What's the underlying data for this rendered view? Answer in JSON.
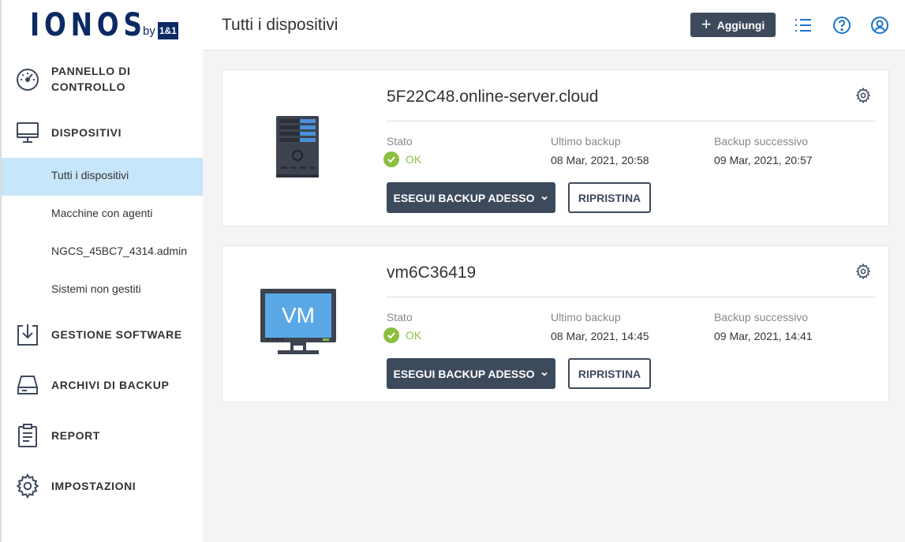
{
  "brand": {
    "name": "IONOS",
    "by": "by",
    "partner": "1&1"
  },
  "sidebar": {
    "items": [
      {
        "label": "PANNELLO DI\nCONTROLLO",
        "icon": "speedometer-icon"
      },
      {
        "label": "DISPOSITIVI",
        "icon": "monitor-icon"
      },
      {
        "label": "GESTIONE SOFTWARE",
        "icon": "download-box-icon"
      },
      {
        "label": "ARCHIVI DI BACKUP",
        "icon": "drive-icon"
      },
      {
        "label": "REPORT",
        "icon": "clipboard-icon"
      },
      {
        "label": "IMPOSTAZIONI",
        "icon": "gear-icon"
      }
    ],
    "subitems": [
      {
        "label": "Tutti i dispositivi",
        "active": true
      },
      {
        "label": "Macchine con agenti"
      },
      {
        "label": "NGCS_45BC7_4314.admin"
      },
      {
        "label": "Sistemi non gestiti"
      }
    ]
  },
  "header": {
    "title": "Tutti i dispositivi",
    "add_label": "Aggiungi",
    "icons": [
      "list-icon",
      "help-icon",
      "account-icon"
    ]
  },
  "devices": [
    {
      "name": "5F22C48.online-server.cloud",
      "icon": "server-icon",
      "status_label": "Stato",
      "status": "OK",
      "last_backup_label": "Ultimo backup",
      "last_backup": "08 Mar, 2021, 20:58",
      "next_backup_label": "Backup successivo",
      "next_backup": "09 Mar, 2021, 20:57",
      "backup_button": "ESEGUI BACKUP ADESSO",
      "restore_button": "RIPRISTINA"
    },
    {
      "name": "vm6C36419",
      "icon": "vm-monitor-icon",
      "icon_text": "VM",
      "status_label": "Stato",
      "status": "OK",
      "last_backup_label": "Ultimo backup",
      "last_backup": "08 Mar, 2021, 14:45",
      "next_backup_label": "Backup successivo",
      "next_backup": "09 Mar, 2021, 14:41",
      "backup_button": "ESEGUI BACKUP ADESSO",
      "restore_button": "RIPRISTINA"
    }
  ],
  "colors": {
    "brand": "#0b2a63",
    "button_dark": "#3d4a5c",
    "active_bg": "#c7e6f9",
    "ok_green": "#8cbf3f",
    "header_icon": "#1a73c9"
  }
}
